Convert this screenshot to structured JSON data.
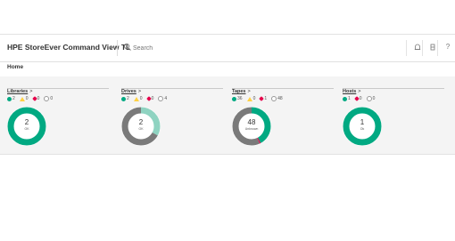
{
  "header": {
    "app_title": "HPE StoreEver Command View TL",
    "search_placeholder": "Search",
    "help_label": "?"
  },
  "breadcrumb": {
    "current": "Home"
  },
  "colors": {
    "ok": "#01a982",
    "warning": "#ffd144",
    "critical": "#e5004c",
    "unknown": "#999999",
    "secondary": "#7a7a7a",
    "light": "#8fd3c1"
  },
  "cards": [
    {
      "title": "Libraries",
      "arrow": ">",
      "stats": {
        "ok": "2",
        "warning": "0",
        "critical": "0",
        "unknown": "0"
      },
      "donut": {
        "value": "2",
        "label": "OK",
        "segments": [
          {
            "fraction": 1.0,
            "color": "#01a982"
          }
        ]
      }
    },
    {
      "title": "Drives",
      "arrow": ">",
      "stats": {
        "ok": "2",
        "warning": "0",
        "critical": "0",
        "unknown": "4"
      },
      "donut": {
        "value": "2",
        "label": "OK",
        "segments": [
          {
            "fraction": 0.33,
            "color": "#8fd3c1"
          },
          {
            "fraction": 0.67,
            "color": "#7a7a7a"
          }
        ]
      }
    },
    {
      "title": "Tapes",
      "arrow": ">",
      "stats": {
        "ok": "36",
        "warning": "0",
        "critical": "1",
        "unknown": "48"
      },
      "donut": {
        "value": "48",
        "label": "Unknown",
        "segments": [
          {
            "fraction": 0.42,
            "color": "#01a982"
          },
          {
            "fraction": 0.01,
            "color": "#e5004c"
          },
          {
            "fraction": 0.57,
            "color": "#7a7a7a"
          }
        ]
      }
    },
    {
      "title": "Hosts",
      "arrow": ">",
      "stats": {
        "ok": "1",
        "critical": "0",
        "unknown": "0"
      },
      "donut": {
        "value": "1",
        "label": "Ok",
        "segments": [
          {
            "fraction": 1.0,
            "color": "#01a982"
          }
        ]
      }
    }
  ]
}
